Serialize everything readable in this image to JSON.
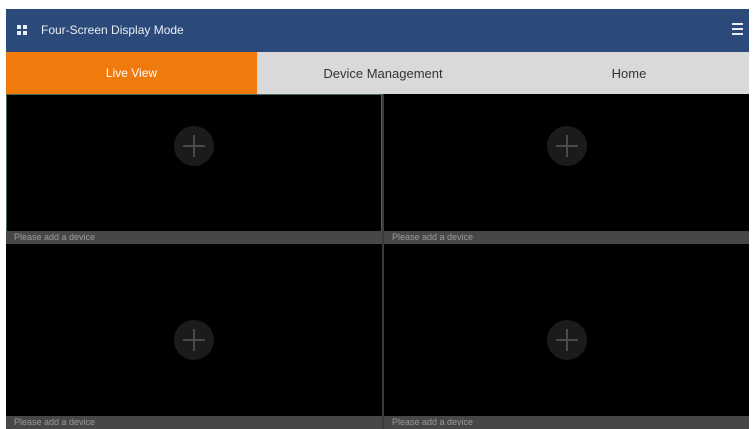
{
  "header": {
    "mode_icon": "grid-icon",
    "title": "Four-Screen Display Mode",
    "menu_icon": "hamburger-menu-icon",
    "background_color": "#2b4a79"
  },
  "tabs": [
    {
      "label": "Live View",
      "active": true
    },
    {
      "label": "Device Management",
      "active": false
    },
    {
      "label": "Home",
      "active": false
    }
  ],
  "accent_color": "#f07a0c",
  "screens": [
    {
      "caption": "Please add a device",
      "add_icon": "plus-icon",
      "selected": true
    },
    {
      "caption": "Please add a device",
      "add_icon": "plus-icon",
      "selected": false
    },
    {
      "caption": "Please add a device",
      "add_icon": "plus-icon",
      "selected": false
    },
    {
      "caption": "Please add a device",
      "add_icon": "plus-icon",
      "selected": false
    }
  ]
}
